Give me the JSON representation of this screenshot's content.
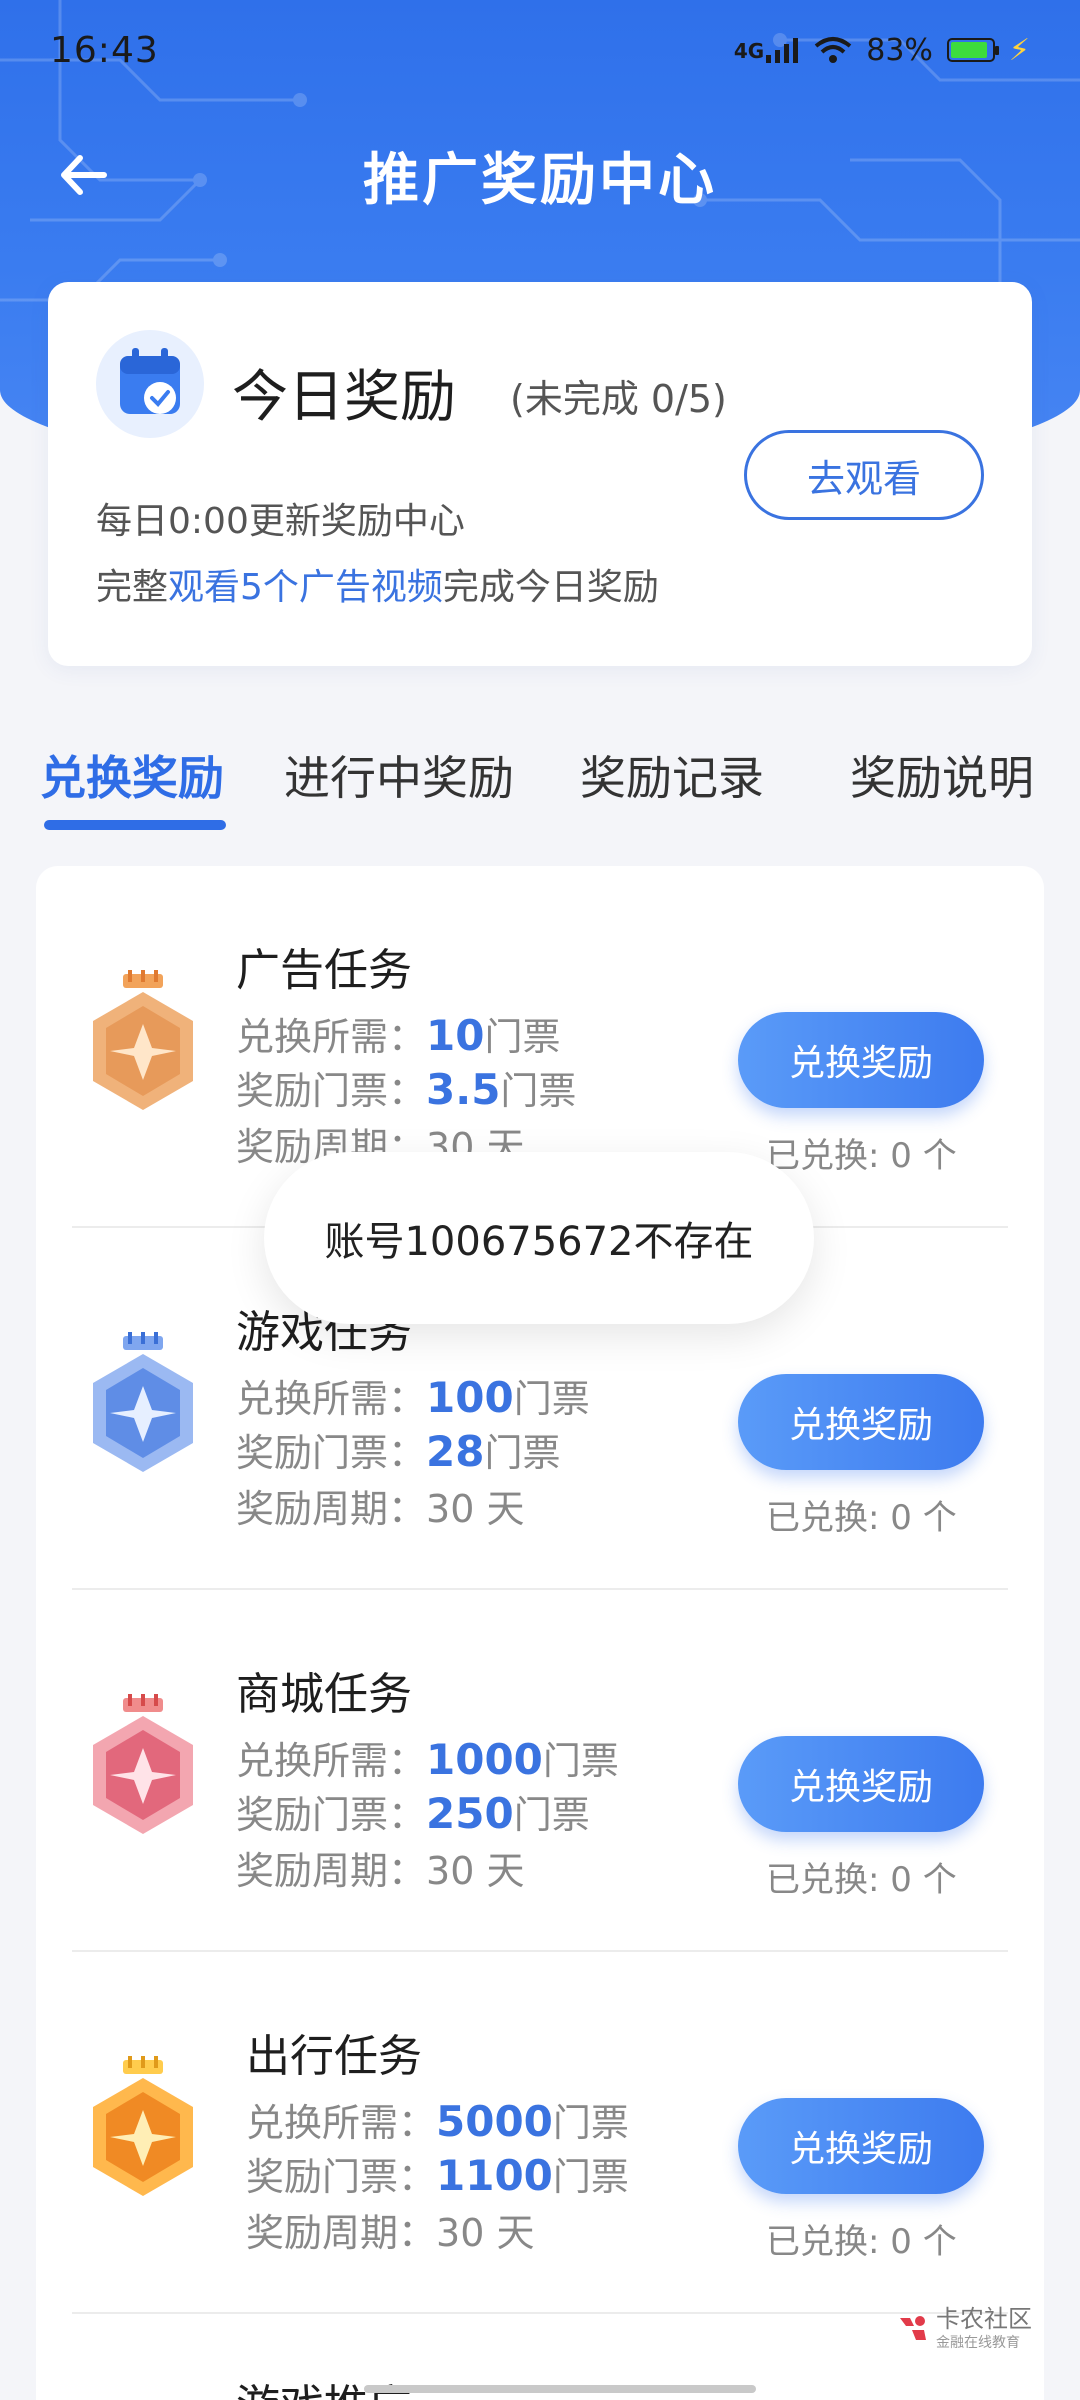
{
  "status_bar": {
    "time": "16:43",
    "network": "4G",
    "battery": "83%",
    "icons": [
      "signal-icon",
      "wifi-icon",
      "battery-icon",
      "charging-icon"
    ]
  },
  "header": {
    "title": "推广奖励中心",
    "back_icon": "arrow-left-icon",
    "accent_color": "#2f70ea"
  },
  "daily": {
    "title": "今日奖励",
    "progress": "(未完成 0/5)",
    "button": "去观看",
    "line1": "每日0:00更新奖励中心",
    "line2_prefix": "完整",
    "line2_highlight": "观看5个广告视频",
    "line2_suffix": "完成今日奖励"
  },
  "tabs": [
    {
      "label": "兑换奖励",
      "active": true
    },
    {
      "label": "进行中奖励",
      "active": false
    },
    {
      "label": "奖励记录",
      "active": false
    },
    {
      "label": "奖励说明",
      "active": false
    }
  ],
  "labels": {
    "need": "兑换所需：",
    "reward": "奖励门票：",
    "period": "奖励周期：",
    "unit_ticket": "门票",
    "unit_day": "天",
    "button": "兑换奖励"
  },
  "items": [
    {
      "title": "广告任务",
      "need": "10",
      "reward": "3.5",
      "period": "30",
      "redeemed": "已兑换: 0 个",
      "medal": "bronze"
    },
    {
      "title": "游戏任务",
      "need": "100",
      "reward": "28",
      "period": "30",
      "redeemed": "已兑换: 0 个",
      "medal": "blue"
    },
    {
      "title": "商城任务",
      "need": "1000",
      "reward": "250",
      "period": "30",
      "redeemed": "已兑换: 0 个",
      "medal": "red"
    },
    {
      "title": "出行任务",
      "need": "5000",
      "reward": "1100",
      "period": "30",
      "redeemed": "已兑换: 0 个",
      "medal": "gold"
    }
  ],
  "next_item_title": "游戏推广",
  "toast": "账号100675672不存在",
  "watermark": {
    "title": "卡农社区",
    "subtitle": "金融在线教育"
  }
}
